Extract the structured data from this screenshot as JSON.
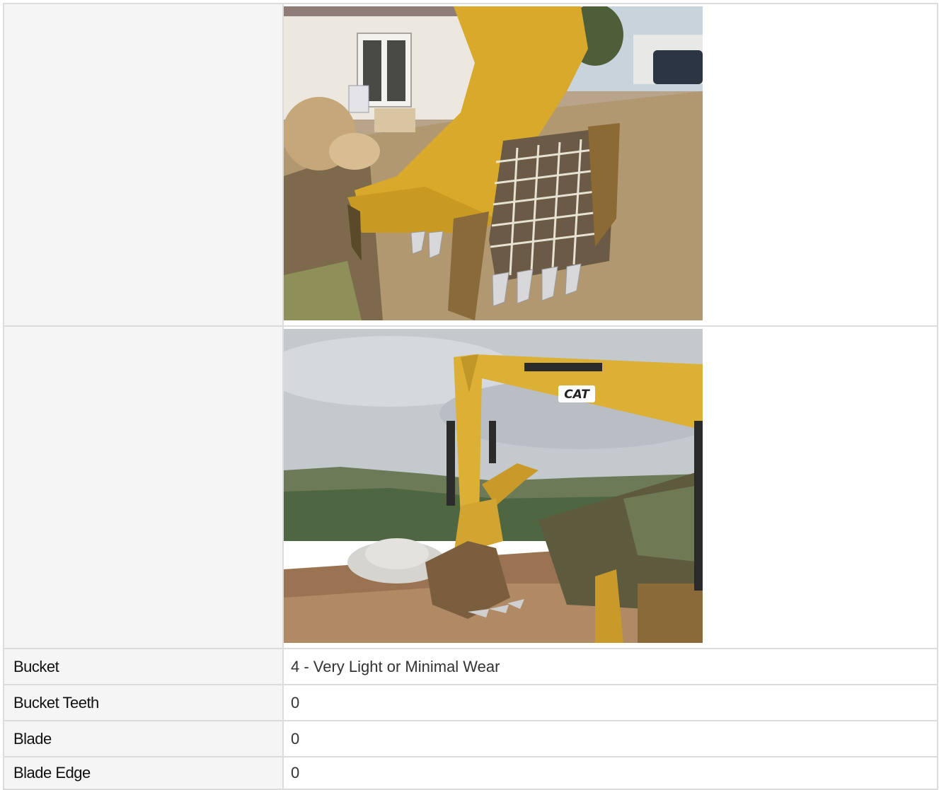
{
  "rows": [
    {
      "label": "Bucket",
      "value": "4 - Very Light or Minimal Wear"
    },
    {
      "label": "Bucket Teeth",
      "value": "0"
    },
    {
      "label": "Blade",
      "value": "0"
    },
    {
      "label": "Blade Edge",
      "value": "0"
    }
  ],
  "brand_colors": {
    "cat_yellow": "#E0B030",
    "border": "#DCDCDC",
    "label_bg": "#F5F5F5"
  },
  "logo_text": "CAT"
}
